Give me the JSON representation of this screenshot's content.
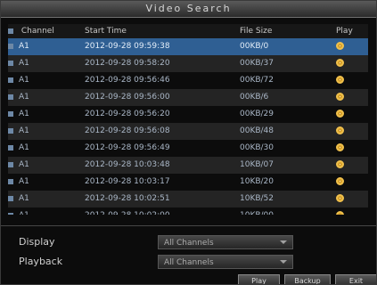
{
  "window": {
    "title": "Video Search"
  },
  "table": {
    "headers": {
      "channel": "Channel",
      "start_time": "Start Time",
      "file_size": "File Size",
      "play": "Play"
    },
    "rows": [
      {
        "channel": "A1",
        "start_time": "2012-09-28 09:59:38",
        "file_size": "00KB/0",
        "selected": true
      },
      {
        "channel": "A1",
        "start_time": "2012-09-28 09:58:20",
        "file_size": "00KB/37"
      },
      {
        "channel": "A1",
        "start_time": "2012-09-28 09:56:46",
        "file_size": "00KB/72"
      },
      {
        "channel": "A1",
        "start_time": "2012-09-28 09:56:00",
        "file_size": "00KB/6"
      },
      {
        "channel": "A1",
        "start_time": "2012-09-28 09:56:20",
        "file_size": "00KB/29"
      },
      {
        "channel": "A1",
        "start_time": "2012-09-28 09:56:08",
        "file_size": "00KB/48"
      },
      {
        "channel": "A1",
        "start_time": "2012-09-28 09:56:49",
        "file_size": "00KB/30"
      },
      {
        "channel": "A1",
        "start_time": "2012-09-28 10:03:48",
        "file_size": "10KB/07"
      },
      {
        "channel": "A1",
        "start_time": "2012-09-28 10:03:17",
        "file_size": "10KB/20"
      },
      {
        "channel": "A1",
        "start_time": "2012-09-28 10:02:51",
        "file_size": "10KB/52"
      },
      {
        "channel": "A1",
        "start_time": "2012-09-28 10:02:00",
        "file_size": "10KB/00",
        "partial": true
      }
    ]
  },
  "form": {
    "display_label": "Display",
    "display_value": "All Channels",
    "playback_label": "Playback",
    "playback_value": "All Channels"
  },
  "buttons": [
    {
      "label": "Play"
    },
    {
      "label": "Backup"
    },
    {
      "label": "Exit"
    }
  ]
}
